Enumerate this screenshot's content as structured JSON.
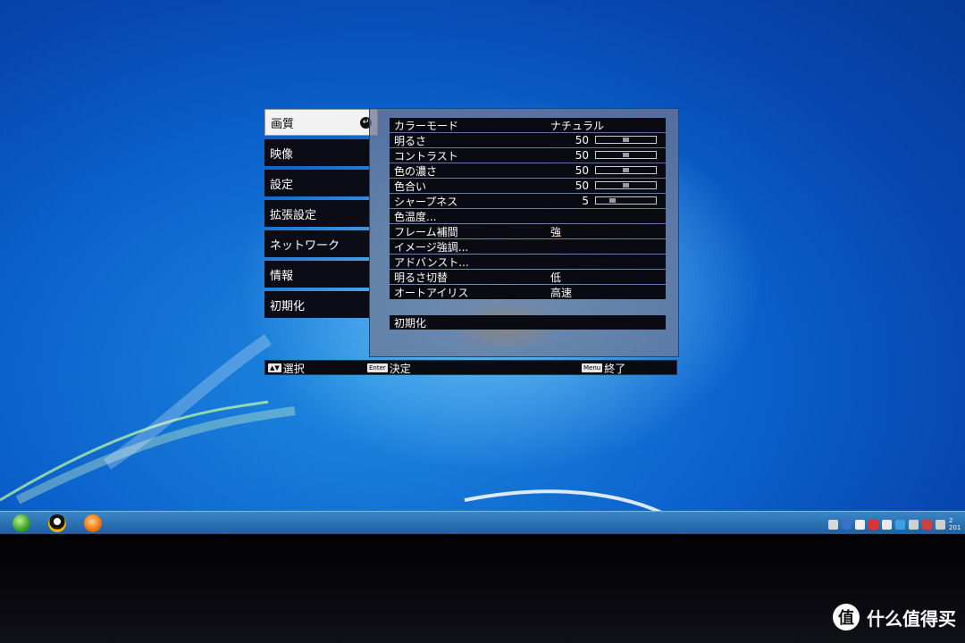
{
  "osd": {
    "tabs": [
      {
        "label": "画質",
        "active": true
      },
      {
        "label": "映像"
      },
      {
        "label": "設定"
      },
      {
        "label": "拡張設定"
      },
      {
        "label": "ネットワーク"
      },
      {
        "label": "情報"
      },
      {
        "label": "初期化"
      }
    ],
    "items": [
      {
        "label": "カラーモード",
        "value": "ナチュラル"
      },
      {
        "label": "明るさ",
        "number": "50",
        "level": 0.5
      },
      {
        "label": "コントラスト",
        "number": "50",
        "level": 0.5
      },
      {
        "label": "色の濃さ",
        "number": "50",
        "level": 0.5
      },
      {
        "label": "色合い",
        "number": "50",
        "level": 0.5
      },
      {
        "label": "シャープネス",
        "number": "5",
        "level": 0.25
      },
      {
        "label": "色温度..."
      },
      {
        "label": "フレーム補間",
        "value": "強"
      },
      {
        "label": "イメージ強調..."
      },
      {
        "label": "アドバンスト..."
      },
      {
        "label": "明るさ切替",
        "value": "低"
      },
      {
        "label": "オートアイリス",
        "value": "高速"
      }
    ],
    "reset_label": "初期化",
    "footer": {
      "select_key": "▲▼",
      "select_label": "選択",
      "enter_key": "Enter",
      "enter_label": "決定",
      "menu_key": "Menu",
      "menu_label": "終了"
    }
  },
  "taskbar": {
    "icons": [
      "start-orb-icon",
      "qq-penguin-icon",
      "browser-icon"
    ],
    "clock_partial": "2 201"
  },
  "watermark": {
    "icon_glyph": "值",
    "text": "什么值得买"
  }
}
